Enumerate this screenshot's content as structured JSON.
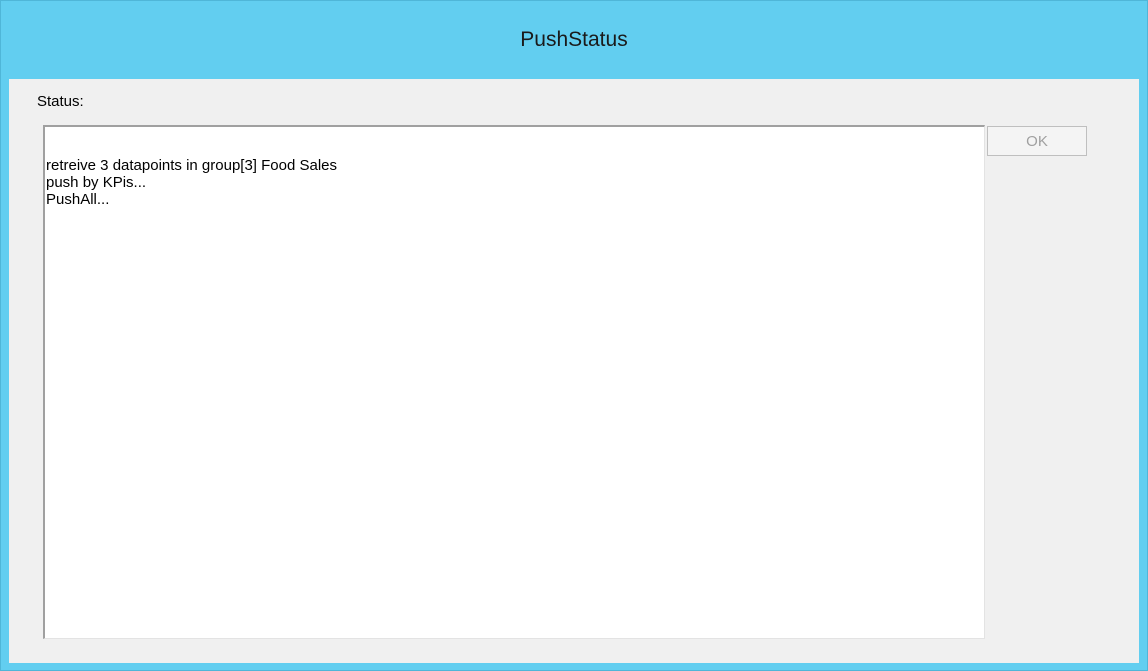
{
  "window": {
    "title": "PushStatus",
    "accent_color": "#62cef0"
  },
  "status": {
    "label": "Status:",
    "lines": [
      "retreive 3 datapoints in group[3] Food Sales",
      "push by KPis...",
      "PushAll..."
    ]
  },
  "buttons": {
    "ok_label": "OK",
    "ok_enabled": false
  }
}
